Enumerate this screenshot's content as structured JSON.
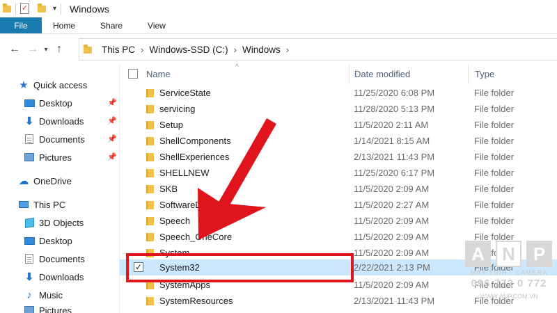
{
  "window": {
    "title": "Windows"
  },
  "ribbon": {
    "tabs": [
      "File",
      "Home",
      "Share",
      "View"
    ]
  },
  "address": {
    "crumbs": [
      "This PC",
      "Windows-SSD (C:)",
      "Windows"
    ]
  },
  "sidebar": {
    "quick_access": "Quick access",
    "quick_items": [
      "Desktop",
      "Downloads",
      "Documents",
      "Pictures"
    ],
    "onedrive": "OneDrive",
    "this_pc": "This PC",
    "pc_items": [
      "3D Objects",
      "Desktop",
      "Documents",
      "Downloads",
      "Music",
      "Pictures"
    ]
  },
  "columns": {
    "name": "Name",
    "date": "Date modified",
    "type": "Type"
  },
  "rows": [
    {
      "name": "ServiceState",
      "date": "11/25/2020 6:08 PM",
      "type": "File folder"
    },
    {
      "name": "servicing",
      "date": "11/28/2020 5:13 PM",
      "type": "File folder"
    },
    {
      "name": "Setup",
      "date": "11/5/2020 2:11 AM",
      "type": "File folder"
    },
    {
      "name": "ShellComponents",
      "date": "1/14/2021 8:15 AM",
      "type": "File folder"
    },
    {
      "name": "ShellExperiences",
      "date": "2/13/2021 11:43 PM",
      "type": "File folder"
    },
    {
      "name": "SHELLNEW",
      "date": "11/25/2020 6:17 PM",
      "type": "File folder"
    },
    {
      "name": "SKB",
      "date": "11/5/2020 2:09 AM",
      "type": "File folder"
    },
    {
      "name": "SoftwareDistribution",
      "date": "11/5/2020 2:27 AM",
      "type": "File folder"
    },
    {
      "name": "Speech",
      "date": "11/5/2020 2:09 AM",
      "type": "File folder"
    },
    {
      "name": "Speech_OneCore",
      "date": "11/5/2020 2:09 AM",
      "type": "File folder"
    },
    {
      "name": "System",
      "date": "11/5/2020 2:09 AM",
      "type": "File folder"
    },
    {
      "name": "System32",
      "date": "2/22/2021 2:13 PM",
      "type": "File folder",
      "selected": true
    },
    {
      "name": "SystemApps",
      "date": "11/5/2020 2:09 AM",
      "type": "File folder"
    },
    {
      "name": "SystemResources",
      "date": "2/13/2021 11:43 PM",
      "type": "File folder"
    }
  ],
  "watermark": {
    "letters": [
      "A",
      "N",
      "P"
    ],
    "tagline": "MÁY TÍNH - CAMERA",
    "phone": "096 772 0 772",
    "url": "WWW.ANP.COM.VN"
  },
  "colors": {
    "accent": "#1a7bb0",
    "selection": "#cce8ff",
    "annotation": "#e0141c"
  }
}
